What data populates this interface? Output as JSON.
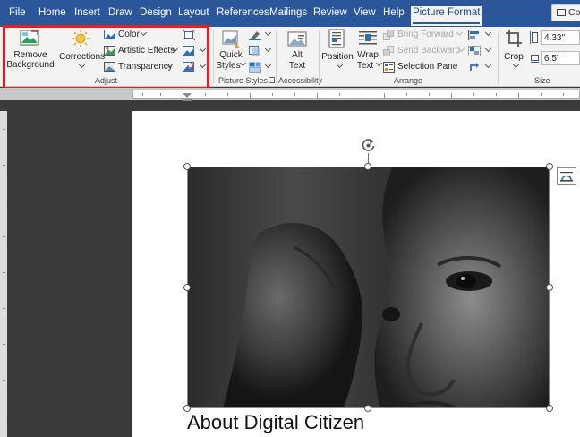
{
  "tabs": {
    "file": "File",
    "home": "Home",
    "insert": "Insert",
    "draw": "Draw",
    "design": "Design",
    "layout": "Layout",
    "references": "References",
    "mailings": "Mailings",
    "review": "Review",
    "view": "View",
    "help": "Help",
    "picture_format": "Picture Format",
    "comments": "Co"
  },
  "ribbon": {
    "adjust": {
      "remove_background": [
        "Remove",
        "Background"
      ],
      "corrections": "Corrections",
      "color": "Color",
      "artistic_effects": "Artistic Effects",
      "transparency": "Transparency",
      "group_label": "Adjust"
    },
    "picture_styles": {
      "quick_styles": [
        "Quick",
        "Styles"
      ],
      "group_label": "Picture Styles"
    },
    "accessibility": {
      "alt_text": [
        "Alt",
        "Text"
      ],
      "group_label": "Accessibility"
    },
    "arrange": {
      "position": "Position",
      "wrap_text": [
        "Wrap",
        "Text"
      ],
      "bring_forward": "Bring Forward",
      "send_backward": "Send Backward",
      "selection_pane": "Selection Pane",
      "group_label": "Arrange"
    },
    "size": {
      "crop": "Crop",
      "height": "4.33\"",
      "width": "6.5\"",
      "group_label": "Size"
    }
  },
  "document": {
    "text": "About Digital Citizen"
  },
  "colors": {
    "accent": "#2b579a",
    "highlight": "#e81e25"
  }
}
